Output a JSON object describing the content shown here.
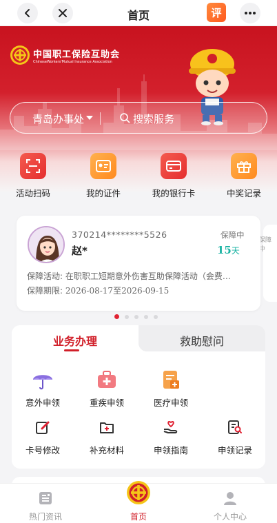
{
  "nav": {
    "title": "首页",
    "badge_text": "评"
  },
  "hero": {
    "logo_cn": "中国职工保险互助会",
    "logo_en": "ChineseWorkers'Mutual Insurance Association",
    "city": "青岛办事处",
    "search_placeholder": "搜索服务"
  },
  "quick_entries": [
    {
      "label": "活动扫码",
      "icon": "scan-icon"
    },
    {
      "label": "我的证件",
      "icon": "id-card-icon"
    },
    {
      "label": "我的银行卡",
      "icon": "bank-card-icon"
    },
    {
      "label": "中奖记录",
      "icon": "gift-icon"
    }
  ],
  "member_card": {
    "id_number": "370214********5526",
    "name": "赵*",
    "status": "保障中",
    "days_value": "15",
    "days_unit": "天",
    "activity_label": "保障活动:",
    "activity_value": "在职职工短期意外伤害互助保障活动（会费…",
    "period_label": "保障期限:",
    "period_value": "2026-08-17至2026-09-15",
    "peek_status": "保障中"
  },
  "carousel": {
    "count": 5,
    "active": 0
  },
  "business": {
    "tab_active": "业务办理",
    "tab_other": "救助慰问",
    "services_row1": [
      {
        "label": "意外申领",
        "icon": "umbrella-icon"
      },
      {
        "label": "重疾申领",
        "icon": "medical-kit-icon"
      },
      {
        "label": "医疗申领",
        "icon": "medical-document-icon"
      }
    ],
    "services_row2": [
      {
        "label": "卡号修改",
        "icon": "edit-icon"
      },
      {
        "label": "补充材料",
        "icon": "folder-add-icon"
      },
      {
        "label": "申领指南",
        "icon": "hand-heart-icon"
      },
      {
        "label": "申领记录",
        "icon": "record-search-icon"
      }
    ]
  },
  "bottom_nav": [
    {
      "label": "热门资讯",
      "icon": "news-icon",
      "active": false
    },
    {
      "label": "首页",
      "icon": "emblem-icon",
      "active": true
    },
    {
      "label": "个人中心",
      "icon": "person-icon",
      "active": false
    }
  ],
  "colors": {
    "brand_red": "#d11f29",
    "teal": "#1ab3a3"
  }
}
